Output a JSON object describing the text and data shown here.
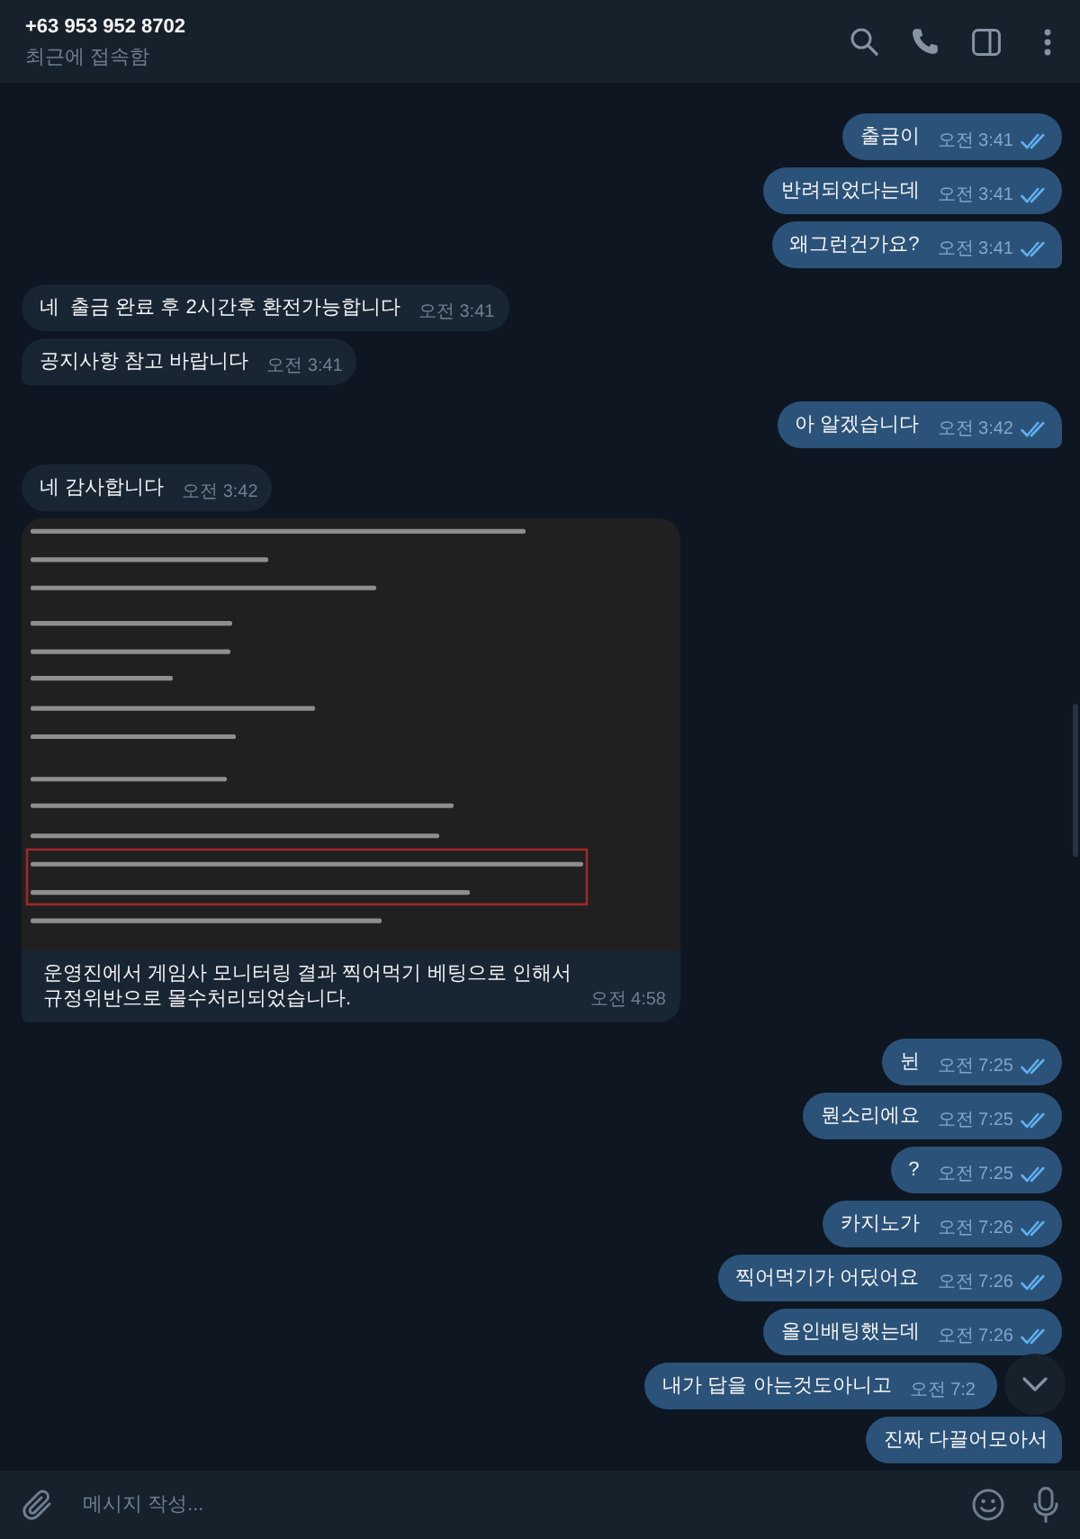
{
  "header": {
    "title": "+63 953 952 8702",
    "status": "최근에 접속함"
  },
  "messages": [
    {
      "kind": "outgoing",
      "text": "출금이",
      "time": "오전 3:41",
      "read": true
    },
    {
      "kind": "outgoing",
      "text": "반려되었다는데",
      "time": "오전 3:41",
      "read": true
    },
    {
      "kind": "outgoing",
      "text": "왜그런건가요?",
      "time": "오전 3:41",
      "read": true
    },
    {
      "kind": "incoming",
      "text": "네  출금 완료 후 2시간후 환전가능합니다",
      "time": "오전 3:41"
    },
    {
      "kind": "incoming",
      "text": "공지사항 참고 바랍니다",
      "time": "오전 3:41"
    },
    {
      "kind": "outgoing",
      "text": "아 알겠습니다",
      "time": "오전 3:42",
      "read": true
    },
    {
      "kind": "incoming",
      "text": "네 감사합니다",
      "time": "오전 3:42"
    },
    {
      "kind": "photo",
      "caption": "운영진에서 게임사 모니터링 결과 찍어먹기 베팅으로 인해서\n규정위반으로 몰수처리되었습니다.",
      "time": "오전 4:58"
    },
    {
      "kind": "outgoing",
      "text": "뉜",
      "time": "오전 7:25",
      "read": true
    },
    {
      "kind": "outgoing",
      "text": "뭔소리에요",
      "time": "오전 7:25",
      "read": true
    },
    {
      "kind": "outgoing",
      "text": "?",
      "time": "오전 7:25",
      "read": true
    },
    {
      "kind": "outgoing",
      "text": "카지노가",
      "time": "오전 7:26",
      "read": true
    },
    {
      "kind": "outgoing",
      "text": "찍어먹기가 어딨어요",
      "time": "오전 7:26",
      "read": true
    },
    {
      "kind": "outgoing",
      "text": "올인배팅했는데",
      "time": "오전 7:26",
      "read": true
    },
    {
      "kind": "outgoing",
      "text": "내가 답을 아는것도아니고",
      "time": "오전 7:2"
    },
    {
      "kind": "outgoing",
      "text": "진짜 다끌어모아서"
    }
  ],
  "composer": {
    "placeholder": "메시지 작성..."
  }
}
